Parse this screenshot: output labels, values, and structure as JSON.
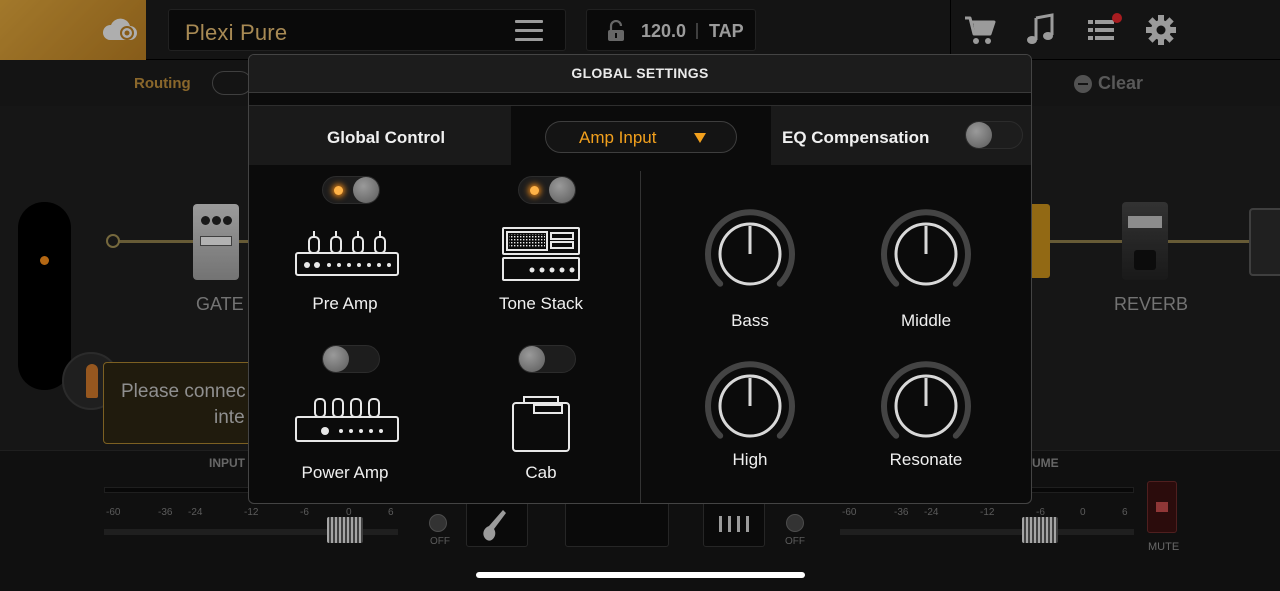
{
  "topbar": {
    "preset_name": "Plexi Pure",
    "tempo_value": "120.0",
    "tap_label": "TAP",
    "icons": [
      "cloud-icon",
      "menu-icon",
      "lock-icon",
      "cart-icon",
      "music-note-icon",
      "list-icon",
      "gear-icon"
    ],
    "notification_color": "#e0262b"
  },
  "background": {
    "routing_label": "Routing",
    "clear_label": "Clear",
    "gate_label": "GATE",
    "reverb_label": "REVERB",
    "toast_line1": "Please connec",
    "toast_line2": "inte",
    "input_label": "INPUT",
    "volume_label_partial": "UME",
    "meter_scale": [
      "-60",
      "-36",
      "-24",
      "-12",
      "-6",
      "0",
      "6"
    ],
    "off_label": "OFF",
    "mute_label": "MUTE"
  },
  "modal": {
    "title": "GLOBAL SETTINGS",
    "global_control_label": "Global Control",
    "dropdown_value": "Amp Input",
    "eq_compensation_label": "EQ Compensation",
    "eq_compensation_on": false,
    "accent_color": "#f2a01d",
    "modules": [
      {
        "label": "Pre Amp",
        "on": true
      },
      {
        "label": "Tone Stack",
        "on": true
      },
      {
        "label": "Power Amp",
        "on": false
      },
      {
        "label": "Cab",
        "on": false
      }
    ],
    "knobs": [
      {
        "label": "Bass",
        "value": 0.5
      },
      {
        "label": "Middle",
        "value": 0.5
      },
      {
        "label": "High",
        "value": 0.5
      },
      {
        "label": "Resonate",
        "value": 0.5
      }
    ]
  }
}
